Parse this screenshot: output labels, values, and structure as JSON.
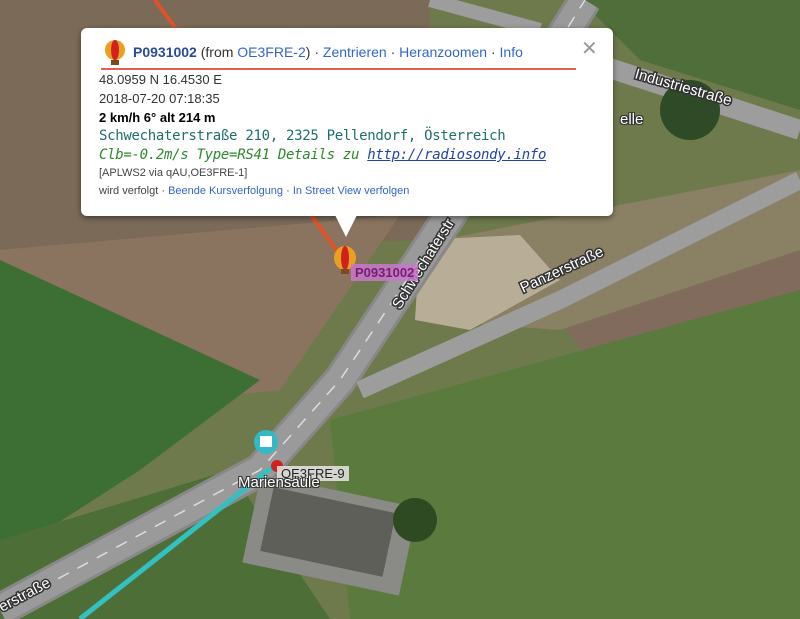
{
  "popup": {
    "callsign": "P0931002",
    "from_prefix": "(from ",
    "from_station": "OE3FRE-2",
    "from_suffix": ")",
    "link_center": "Zentrieren",
    "link_zoom": "Heranzoomen",
    "link_info": "Info",
    "separator": " · ",
    "close": "✕",
    "coords": "48.0959 N 16.4530 E",
    "timestamp": "2018-07-20 07:18:35",
    "speed_line": "2 km/h 6° alt 214 m",
    "address": "Schwechaterstraße 210, 2325 Pellendorf, Österreich",
    "comment": "Clb=-0.2m/s Type=RS41 Details zu ",
    "comment_link": "http://radiosondy.info",
    "path": "[APLWS2 via qAU,OE3FRE-1]",
    "tracked": "wird verfolgt",
    "stop_tracking": "Beende Kursverfolgung",
    "street_view": "In Street View verfolgen"
  },
  "map": {
    "sonde_label": "P0931002",
    "station_label": "OE3FRE-9",
    "place_label": "Mariensäule",
    "partial_place_label": "elle",
    "street_labels": {
      "industrie": "Industriestraße",
      "schwechater": "Schwechaterstr",
      "panzer": "Panzerstraße",
      "bottom_left": "erstraße"
    },
    "colors": {
      "sonde_track": "#e0522a",
      "station_track": "#33c0c0",
      "balloon_primary": "#e8a020",
      "balloon_secondary": "#d02020"
    }
  }
}
